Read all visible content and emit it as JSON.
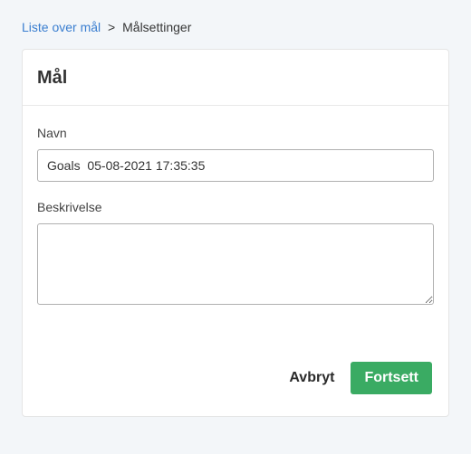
{
  "breadcrumb": {
    "link_text": "Liste over mål",
    "separator": ">",
    "current": "Målsettinger"
  },
  "card": {
    "title": "Mål"
  },
  "form": {
    "name": {
      "label": "Navn",
      "value": "Goals  05-08-2021 17:35:35"
    },
    "description": {
      "label": "Beskrivelse",
      "value": ""
    }
  },
  "actions": {
    "cancel": "Avbryt",
    "continue": "Fortsett"
  }
}
